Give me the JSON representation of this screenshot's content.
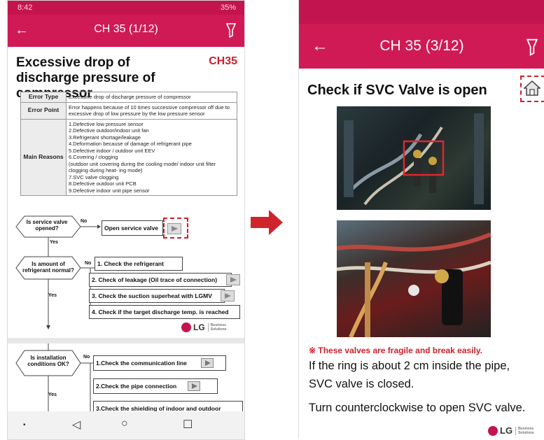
{
  "left": {
    "status": {
      "time": "8:42",
      "right": "35%"
    },
    "appbar": {
      "title": "CH 35 (1/12)"
    },
    "doc": {
      "title": "Excessive drop of discharge pressure of compressor",
      "code": "CH35"
    },
    "table": {
      "rows": [
        {
          "key": "Error Type",
          "value": "Excessive drop of discharge pressure of compressor"
        },
        {
          "key": "Error Point",
          "value": "Error happens because of 10  times successive compressor off due to excessive drop of low pressure by the low pressure sensor"
        },
        {
          "key": "Main Reasons",
          "value": "1.Defective low pressure sensor\n2.Defective outdoor/indoor unit fan\n3.Refrigerant shortage/leakage\n4.Deformation because of damage of refrigerant pipe\n5.Defective indoor / outdoor unit EEV\n6.Covering / clogging\n (outdoor unit covering during the cooling mode/ indoor unit filter clogging during heat- ing mode)\n7.SVC valve clogging\n8.Defective outdoor unit PCB\n9.Defective indoor unit pipe sensor"
        }
      ]
    },
    "flow1": {
      "q1": "Is service valve opened?",
      "no": "No",
      "yes": "Yes",
      "open_valve": "Open service valve",
      "q2": "Is amount of refrigerant normal?",
      "checks": [
        "1. Check the refrigerant",
        "2. Check of leakage (Oil trace of connection)",
        "3. Check the suction superheat with LGMV",
        "4. Check if the target discharge temp. is reached"
      ]
    },
    "flow2": {
      "q": "Is installation conditions OK?",
      "no": "No",
      "yes": "Yes",
      "checks": [
        "1.Check the communication line",
        "2.Check the pipe connection",
        "3.Check the shielding of indoor and outdoor"
      ]
    },
    "logo": {
      "brand": "LG",
      "sub1": "Business",
      "sub2": "Solutions"
    }
  },
  "right": {
    "appbar": {
      "title": "CH 35 (3/12)"
    },
    "heading": "Check if SVC Valve is open",
    "note": "※ These valves are fragile and break easily.",
    "lines": [
      "If the ring is about 2 cm inside the pipe,",
      "SVC valve is closed.",
      "Turn counterclockwise to open SVC valve."
    ],
    "logo": {
      "brand": "LG",
      "sub1": "Business",
      "sub2": "Solutions"
    }
  },
  "colors": {
    "brand": "#cf1a56",
    "alert": "#d01f29"
  },
  "icons": [
    "back-arrow-icon",
    "filter-icon",
    "play-icon",
    "home-icon",
    "nav-back-icon",
    "nav-home-icon",
    "nav-recents-icon"
  ]
}
